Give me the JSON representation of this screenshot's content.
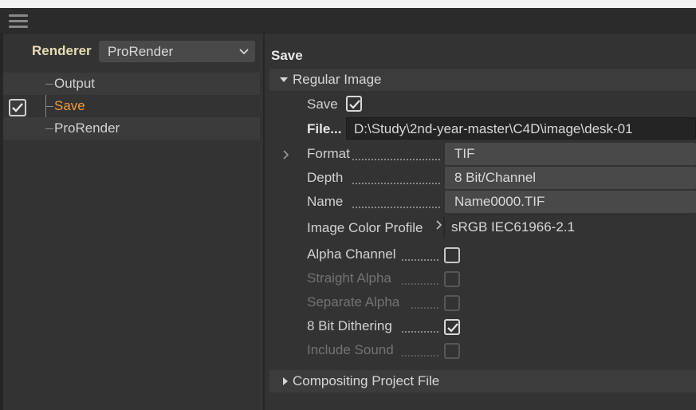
{
  "toolbar": {
    "menu_icon": "hamburger-icon"
  },
  "left_panel": {
    "renderer_label": "Renderer",
    "renderer_value": "ProRender",
    "tree": [
      {
        "label": "Output",
        "checked": false,
        "active": false
      },
      {
        "label": "Save",
        "checked": true,
        "active": true
      },
      {
        "label": "ProRender",
        "checked": false,
        "active": false
      }
    ]
  },
  "right_panel": {
    "section_title": "Save",
    "regular_image": {
      "header": "Regular Image",
      "save_label": "Save",
      "save_checked": true,
      "file_label": "File...",
      "file_value": "D:\\Study\\2nd-year-master\\C4D\\image\\desk-01",
      "format_label": "Format",
      "format_value": "TIF",
      "depth_label": "Depth",
      "depth_value": "8 Bit/Channel",
      "name_label": "Name",
      "name_value": "Name0000.TIF",
      "color_profile_label": "Image Color Profile",
      "color_profile_value": "sRGB IEC61966-2.1",
      "options": [
        {
          "label": "Alpha Channel",
          "checked": false,
          "disabled": false
        },
        {
          "label": "Straight Alpha",
          "checked": false,
          "disabled": true
        },
        {
          "label": "Separate Alpha",
          "checked": false,
          "disabled": true
        },
        {
          "label": "8 Bit Dithering",
          "checked": true,
          "disabled": false
        },
        {
          "label": "Include Sound",
          "checked": false,
          "disabled": true
        }
      ]
    },
    "compositing": {
      "header": "Compositing Project File"
    }
  },
  "colors": {
    "accent": "#f09a3c",
    "panel": "#333333",
    "field": "#494949"
  }
}
